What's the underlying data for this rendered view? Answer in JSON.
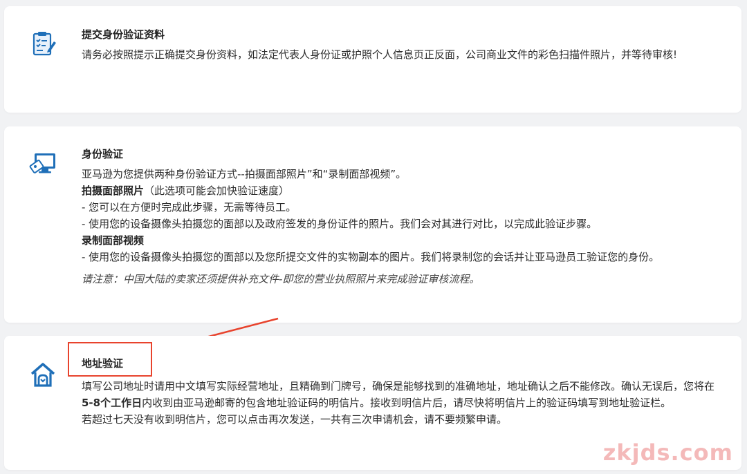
{
  "step1": {
    "title": "提交身份验证资料",
    "description": "请务必按照提示正确提交身份资料，如法定代表人身份证或护照个人信息页正反面，公司商业文件的彩色扫描件照片，并等待审核!"
  },
  "step2": {
    "title": "身份验证",
    "intro": "亚马逊为您提供两种身份验证方式--拍摄面部照片”和“录制面部视频”。",
    "option1_title": "拍摄面部照片",
    "option1_note": "（此选项可能会加快验证速度）",
    "option1_line1": "- 您可以在方便时完成此步骤，无需等待员工。",
    "option1_line2": "- 使用您的设备摄像头拍摄您的面部以及政府签发的身份证件的照片。我们会对其进行对比，以完成此验证步骤。",
    "option2_title": "录制面部视频",
    "option2_line1": "- 使用您的设备摄像头拍摄您的面部以及您所提交文件的实物副本的图片。我们将录制您的会话并让亚马逊员工验证您的身份。",
    "note": "请注意：中国大陆的卖家还须提供补充文件-即您的营业执照照片来完成验证审核流程。"
  },
  "step3": {
    "title": "地址验证",
    "para1_a": "填写公司地址时请用中文填写实际经营地址，且精确到门牌号，确保是能够找到的准确地址，地址确认之后不能修改。确认无误后，您将在",
    "para1_bold": "5-8个工作日",
    "para1_b": "内收到由亚马逊邮寄的包含地址验证码的明信片。接收到明信片后，请尽快将明信片上的验证码填写到地址验证栏。",
    "para2": "若超过七天没有收到明信片，您可以点击再次发送，一共有三次申请机会，请不要频繁申请。"
  },
  "watermark": "zkjds.com",
  "colors": {
    "icon_blue": "#1f6fb8",
    "highlight_red": "#e8432d",
    "watermark": "#f4b9b9"
  },
  "icons": {
    "step1": "document-edit-icon",
    "step2": "monitor-id-icon",
    "step3": "house-icon"
  }
}
